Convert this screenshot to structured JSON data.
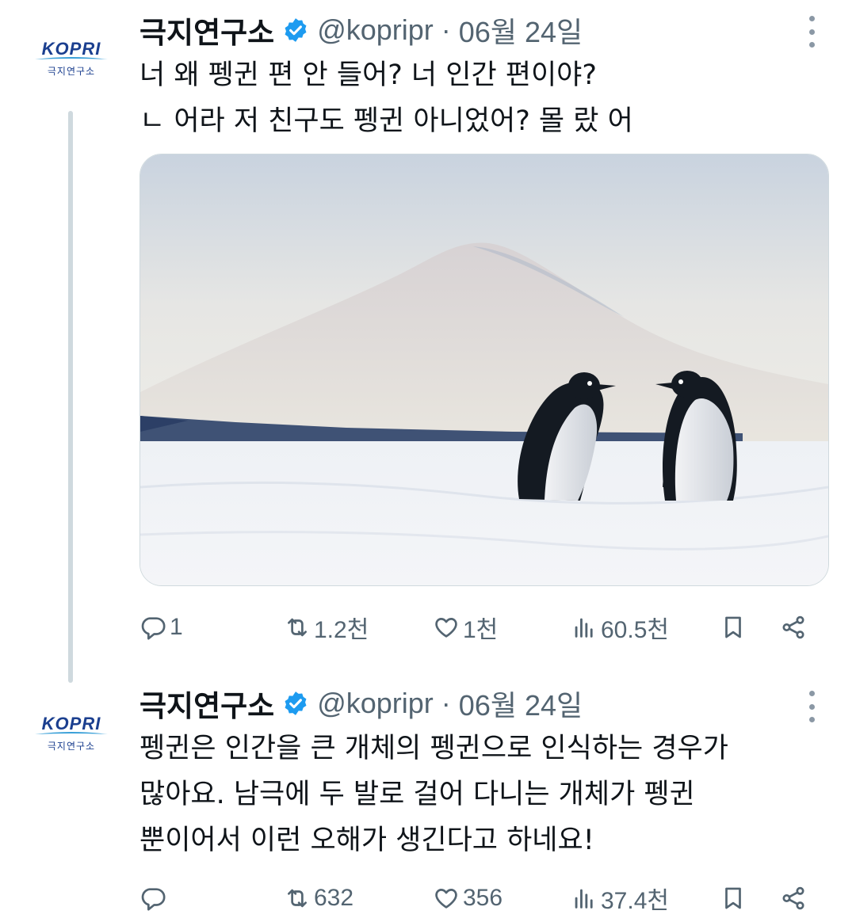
{
  "tweets": [
    {
      "avatar": {
        "logo_text": "KOPRI",
        "logo_sub": "극지연구소"
      },
      "author_name": "극지연구소",
      "handle": "@kopripr",
      "separator": "·",
      "date": "06월 24일",
      "text": "너 왜 펭귄 편 안 들어? 너 인간 편이야?\nㄴ 어라 저 친구도 펭귄 아니었어? 몰 랐 어",
      "image_alt": "two-penguins-on-snow",
      "replies": "1",
      "retweets": "1.2천",
      "likes": "1천",
      "views": "60.5천"
    },
    {
      "avatar": {
        "logo_text": "KOPRI",
        "logo_sub": "극지연구소"
      },
      "author_name": "극지연구소",
      "handle": "@kopripr",
      "separator": "·",
      "date": "06월 24일",
      "text": "펭귄은 인간을 큰 개체의 펭귄으로 인식하는 경우가\n많아요. 남극에 두 발로 걸어 다니는 개체가 펭귄\n뿐이어서 이런 오해가 생긴다고 하네요!",
      "replies": "",
      "retweets": "632",
      "likes": "356",
      "views": "37.4천"
    }
  ],
  "colors": {
    "verified": "#1d9bf0",
    "muted": "#536471",
    "text": "#0f1419",
    "kopri_blue": "#1b3f8f"
  },
  "icons": [
    "verified-badge-icon",
    "more-icon",
    "reply-icon",
    "retweet-icon",
    "like-icon",
    "views-icon",
    "bookmark-icon",
    "share-icon"
  ]
}
